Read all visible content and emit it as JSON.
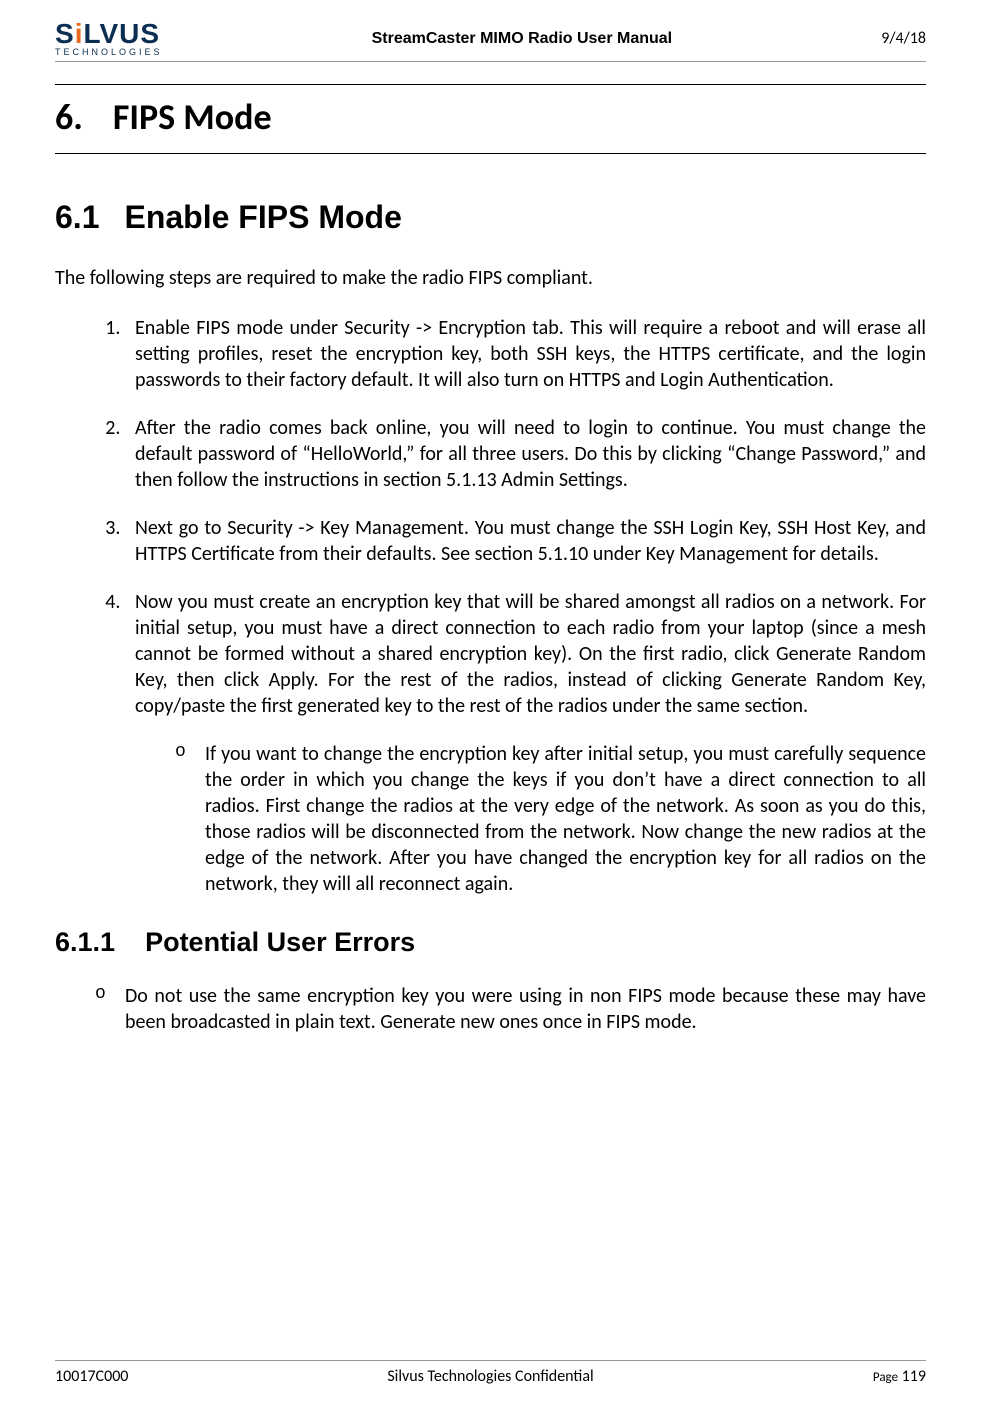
{
  "header": {
    "logo_main_pre": "S",
    "logo_main_accent": "i",
    "logo_main_post": "LVUS",
    "logo_sub": "TECHNOLOGIES",
    "title": "StreamCaster MIMO Radio User Manual",
    "date": "9/4/18"
  },
  "section": {
    "num": "6.",
    "title": "FIPS Mode"
  },
  "subsection": {
    "num": "6.1",
    "title": "Enable FIPS Mode"
  },
  "intro": "The following steps are required to make the radio FIPS compliant.",
  "steps": [
    "Enable FIPS mode under Security -> Encryption tab. This will require a reboot and will erase all setting profiles, reset the encryption key, both SSH keys, the HTTPS certificate, and the login passwords to their factory default. It will also turn on HTTPS and Login Authentication.",
    "After the radio comes back online, you will need to login to continue. You must change the default password of “HelloWorld,” for all three users. Do this by clicking “Change Password,” and then follow the instructions in section 5.1.13 Admin Settings.",
    "Next go to Security -> Key Management.  You must change the SSH Login Key, SSH Host Key, and HTTPS Certificate from their defaults. See section 5.1.10 under Key Management for details.",
    "Now you must create an encryption key that will be shared amongst all radios on a network. For initial setup, you must have a direct connection to each radio from your laptop (since a mesh cannot be formed without a shared encryption key). On the first radio, click Generate Random Key, then click Apply. For the rest of the radios, instead of clicking Generate Random Key, copy/paste the first generated key to the rest of the radios under the same section."
  ],
  "substep": "If you want to change the encryption key after initial setup, you must carefully sequence the order in which you change the keys if you don’t have a direct connection to all radios. First change the radios at the very edge of the network. As soon as you do this, those radios will be disconnected from the network. Now change the new radios at the edge of the network. After you have changed the encryption key for all radios on the network, they will all reconnect again.",
  "subsubsection": {
    "num": "6.1.1",
    "title": "Potential User Errors"
  },
  "errors": [
    "Do not use the same encryption key you were using in non FIPS mode because these may have been broadcasted in plain text. Generate new ones once in FIPS mode."
  ],
  "footer": {
    "doc_num": "10017C000",
    "confidential": "Silvus Technologies Confidential",
    "page_label": "Page",
    "page_num": "119"
  }
}
